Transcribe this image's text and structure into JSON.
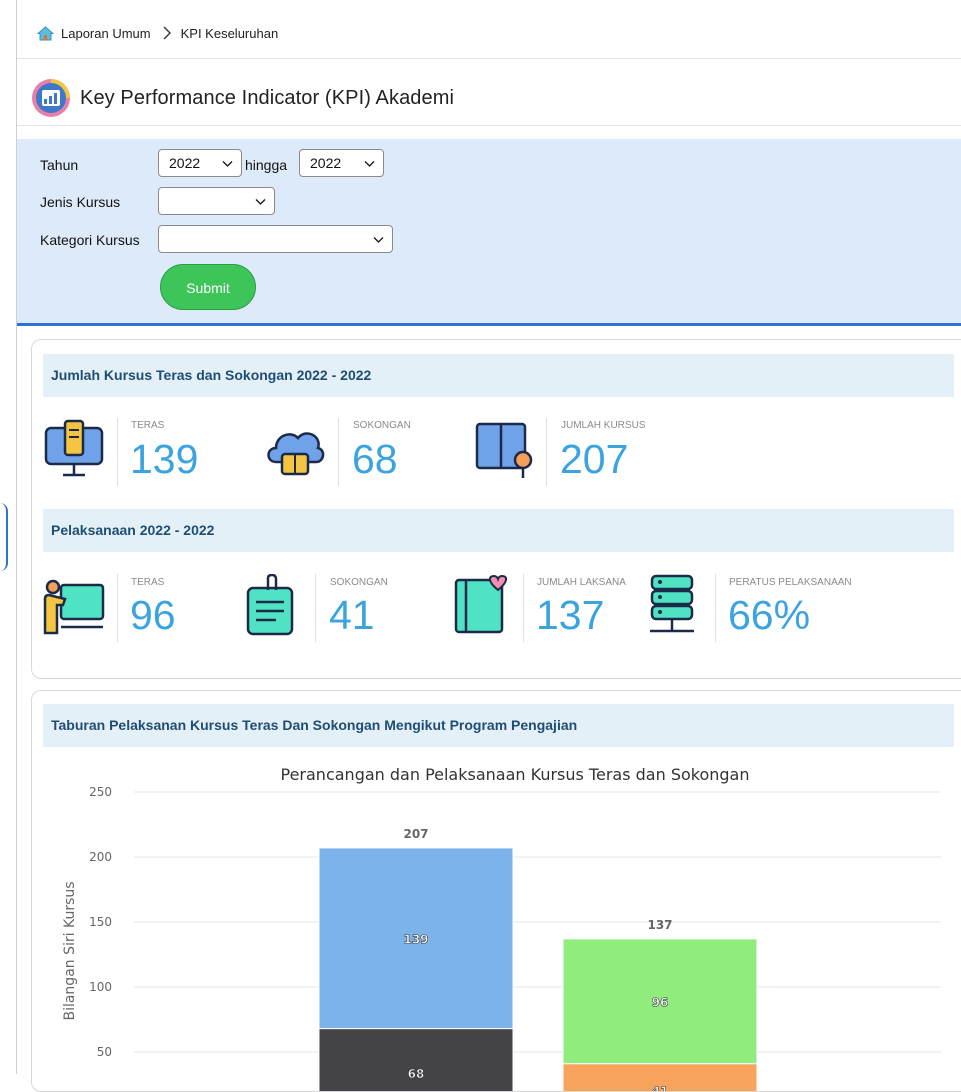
{
  "breadcrumb": {
    "root": "Laporan Umum",
    "current": "KPI Keseluruhan"
  },
  "page": {
    "title": "Key Performance Indicator (KPI) Akademi"
  },
  "filter": {
    "year_label": "Tahun",
    "year_from": "2022",
    "to_label": "hingga",
    "year_to": "2022",
    "course_type_label": "Jenis Kursus",
    "course_type_value": "",
    "course_category_label": "Kategori Kursus",
    "course_category_value": "",
    "submit_label": "Submit"
  },
  "summary": {
    "title": "Jumlah Kursus Teras dan Sokongan 2022 - 2022",
    "teras_label": "TERAS",
    "teras_value": "139",
    "sokongan_label": "SOKONGAN",
    "sokongan_value": "68",
    "jumlah_label": "JUMLAH KURSUS",
    "jumlah_value": "207"
  },
  "pelaksanaan": {
    "title": "Pelaksanaan 2022 - 2022",
    "teras_label": "TERAS",
    "teras_value": "96",
    "sokongan_label": "SOKONGAN",
    "sokongan_value": "41",
    "laksana_label": "JUMLAH LAKSANA",
    "laksana_value": "137",
    "peratus_label": "PERATUS PELAKSANAAN",
    "peratus_value": "66%"
  },
  "taburan": {
    "title": "Taburan Pelaksanan Kursus Teras Dan Sokongan Mengikut Program Pengajian"
  },
  "colors": {
    "accent": "#2f72d6",
    "submit": "#3ec55a",
    "band": "#e3f0f8",
    "stat_value": "#3aa3e0",
    "bar_teras_plan": "#7cb3eb",
    "bar_sokongan_plan": "#434348",
    "bar_teras_done": "#90ed7d",
    "bar_sokongan_done": "#f7a35c"
  },
  "chart_data": {
    "type": "bar",
    "stacked": true,
    "title": "Perancangan dan Pelaksanaan Kursus Teras dan Sokongan",
    "ylabel": "Bilangan Siri Kursus",
    "ylim": [
      0,
      250
    ],
    "yticks": [
      50,
      100,
      150,
      200,
      250
    ],
    "grid": true,
    "stacks": [
      {
        "total": 207,
        "segments": [
          {
            "value": 68,
            "color": "#434348"
          },
          {
            "value": 139,
            "color": "#7cb3eb"
          }
        ]
      },
      {
        "total": 137,
        "segments": [
          {
            "value": 41,
            "color": "#f7a35c"
          },
          {
            "value": 96,
            "color": "#90ed7d"
          }
        ]
      }
    ]
  }
}
